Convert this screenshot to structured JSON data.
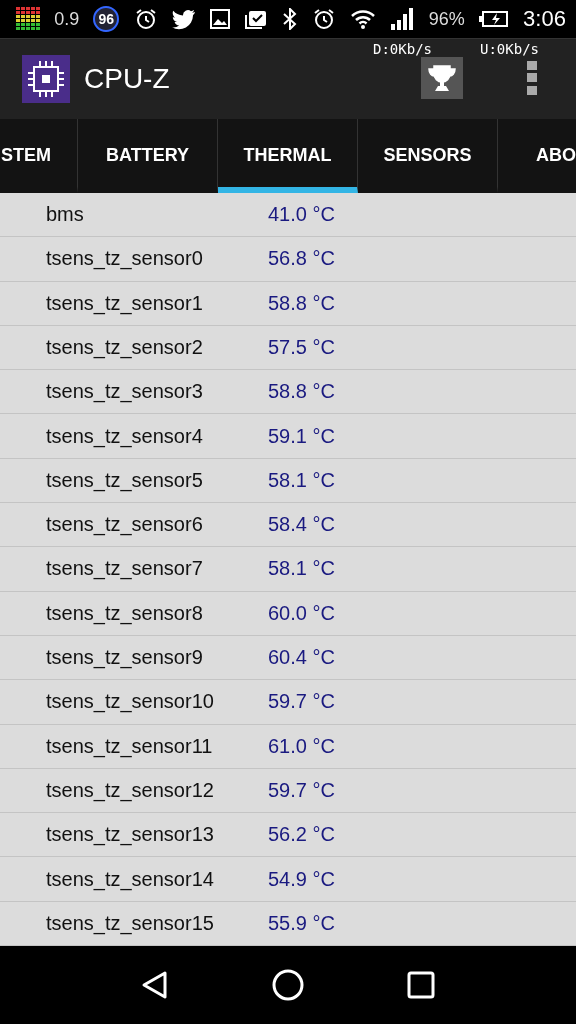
{
  "status_bar": {
    "cpu_load": "0.9",
    "badge": "96",
    "battery": "96%",
    "time": "3:06"
  },
  "app_bar": {
    "title": "CPU-Z",
    "download": "D:0Kb/s",
    "upload": "U:0Kb/s"
  },
  "tabs": [
    {
      "label": "STEM",
      "selected": false
    },
    {
      "label": "BATTERY",
      "selected": false
    },
    {
      "label": "THERMAL",
      "selected": true
    },
    {
      "label": "SENSORS",
      "selected": false
    },
    {
      "label": "ABO",
      "selected": false
    }
  ],
  "rows": [
    {
      "name": "bms",
      "value": "41.0 °C"
    },
    {
      "name": "tsens_tz_sensor0",
      "value": "56.8 °C"
    },
    {
      "name": "tsens_tz_sensor1",
      "value": "58.8 °C"
    },
    {
      "name": "tsens_tz_sensor2",
      "value": "57.5 °C"
    },
    {
      "name": "tsens_tz_sensor3",
      "value": "58.8 °C"
    },
    {
      "name": "tsens_tz_sensor4",
      "value": "59.1 °C"
    },
    {
      "name": "tsens_tz_sensor5",
      "value": "58.1 °C"
    },
    {
      "name": "tsens_tz_sensor6",
      "value": "58.4 °C"
    },
    {
      "name": "tsens_tz_sensor7",
      "value": "58.1 °C"
    },
    {
      "name": "tsens_tz_sensor8",
      "value": "60.0 °C"
    },
    {
      "name": "tsens_tz_sensor9",
      "value": "60.4 °C"
    },
    {
      "name": "tsens_tz_sensor10",
      "value": "59.7 °C"
    },
    {
      "name": "tsens_tz_sensor11",
      "value": "61.0 °C"
    },
    {
      "name": "tsens_tz_sensor12",
      "value": "59.7 °C"
    },
    {
      "name": "tsens_tz_sensor13",
      "value": "56.2 °C"
    },
    {
      "name": "tsens_tz_sensor14",
      "value": "54.9 °C"
    },
    {
      "name": "tsens_tz_sensor15",
      "value": "55.9 °C"
    }
  ]
}
